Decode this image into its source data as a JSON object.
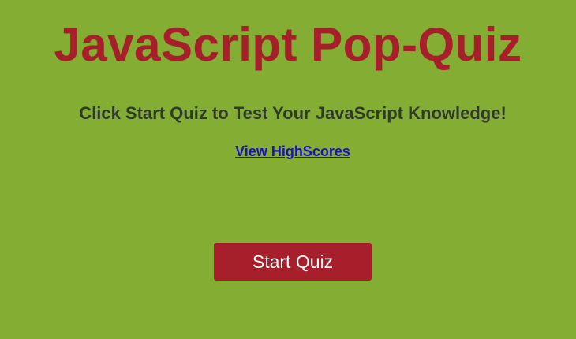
{
  "header": {
    "title": "JavaScript Pop-Quiz"
  },
  "main": {
    "subtitle": "Click Start Quiz to Test Your JavaScript Knowledge!",
    "highscores_link": "View HighScores",
    "start_button": "Start Quiz"
  },
  "colors": {
    "background": "#84ae33",
    "title": "#a61f2a",
    "button": "#a61f2a",
    "link": "#1a10c8"
  }
}
